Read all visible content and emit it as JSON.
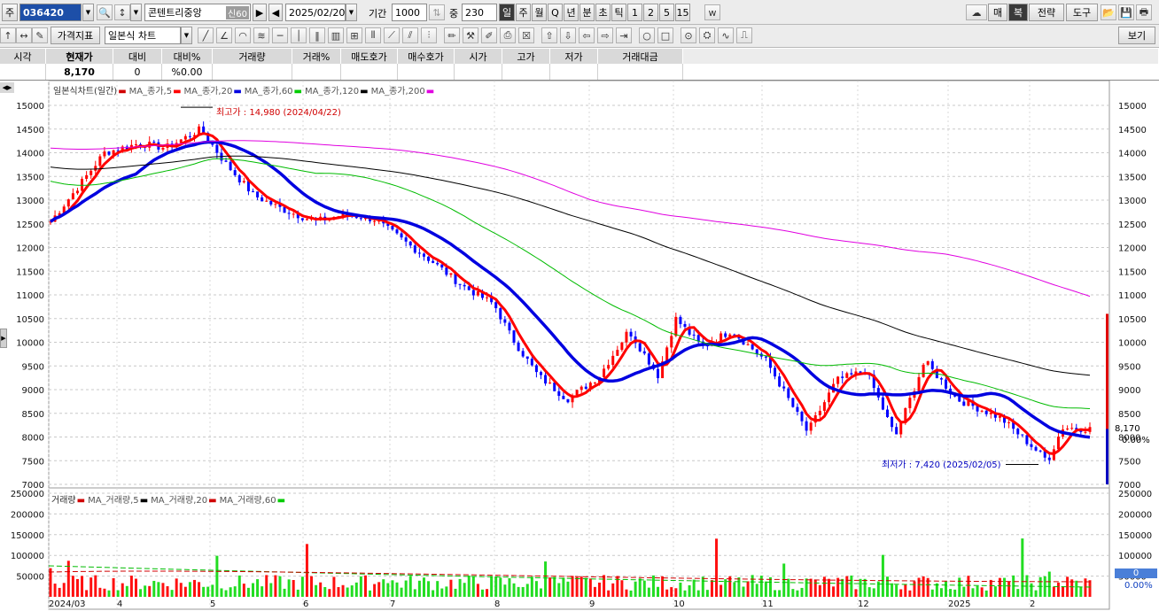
{
  "toolbar1": {
    "market_label": "주",
    "code": "036420",
    "name": "콘텐트리중앙",
    "credit_label": "신",
    "credit_rate": "60",
    "date": "2025/02/20",
    "period_label": "기간",
    "period_value": "1000",
    "weight_label": "중",
    "weight_value": "230",
    "intervals": [
      "일",
      "주",
      "월",
      "Q",
      "년",
      "분",
      "초",
      "틱",
      "1",
      "2",
      "5",
      "15"
    ],
    "right_buttons": [
      "매",
      "복",
      "전략",
      "도구"
    ]
  },
  "toolbar2": {
    "indicator_btn": "가격지표",
    "chart_type": "일본식 차트",
    "view_btn": "보기"
  },
  "quote": {
    "headers": [
      "시각",
      "현재가",
      "대비",
      "대비%",
      "거래량",
      "거래%",
      "매도호가",
      "매수호가",
      "시가",
      "고가",
      "저가",
      "거래대금"
    ],
    "values": [
      "",
      "8,170",
      "0",
      "%0.00",
      "",
      "",
      "",
      "",
      "",
      "",
      "",
      ""
    ]
  },
  "price_legend": [
    {
      "text": "일본식차트(일간)",
      "color": "#d00000"
    },
    {
      "text": "MA_종가,5",
      "color": "#ff0000"
    },
    {
      "text": "MA_종가,20",
      "color": "#0000e0"
    },
    {
      "text": "MA_종가,60",
      "color": "#00cc00"
    },
    {
      "text": "MA_종가,120",
      "color": "#000000"
    },
    {
      "text": "MA_종가,200",
      "color": "#e000e0"
    }
  ],
  "volume_legend": [
    {
      "text": "거래량",
      "color": "#d00000"
    },
    {
      "text": "MA_거래량,5",
      "color": "#000000"
    },
    {
      "text": "MA_거래량,20",
      "color": "#d00000"
    },
    {
      "text": "MA_거래량,60",
      "color": "#00cc00"
    }
  ],
  "annotations": {
    "high": "최고가 : 14,980 (2024/04/22)",
    "low": "최저가 : 7,420 (2025/02/05)",
    "current_price": "8,170",
    "current_change": "0.00%",
    "volume_value": "0",
    "volume_change": "0.00%"
  },
  "chart_data": {
    "type": "candlestick",
    "price_axis": {
      "min": 7000,
      "max": 15000,
      "ticks": [
        "15000",
        "14500",
        "14000",
        "13500",
        "13000",
        "12500",
        "12000",
        "11500",
        "11000",
        "10500",
        "10000",
        "9500",
        "9000",
        "8500",
        "8000",
        "7500",
        "7000"
      ]
    },
    "volume_axis": {
      "ticks": [
        "250000",
        "200000",
        "150000",
        "100000",
        "50000"
      ]
    },
    "x_labels": [
      "2024/03",
      "4",
      "5",
      "6",
      "7",
      "8",
      "9",
      "10",
      "11",
      "12",
      "2025",
      "2"
    ],
    "close_path": [
      [
        "2024-03-01",
        12500
      ],
      [
        "2024-03-10",
        13200
      ],
      [
        "2024-03-20",
        14000
      ],
      [
        "2024-04-01",
        14200
      ],
      [
        "2024-04-10",
        14100
      ],
      [
        "2024-04-22",
        14500
      ],
      [
        "2024-04-30",
        13800
      ],
      [
        "2024-05-10",
        13100
      ],
      [
        "2024-05-20",
        12800
      ],
      [
        "2024-05-31",
        12550
      ],
      [
        "2024-06-10",
        12700
      ],
      [
        "2024-06-20",
        12600
      ],
      [
        "2024-07-01",
        12100
      ],
      [
        "2024-07-10",
        11700
      ],
      [
        "2024-07-20",
        11200
      ],
      [
        "2024-07-31",
        10800
      ],
      [
        "2024-08-06",
        10100
      ],
      [
        "2024-08-15",
        9300
      ],
      [
        "2024-08-25",
        8800
      ],
      [
        "2024-09-01",
        9100
      ],
      [
        "2024-09-05",
        9300
      ],
      [
        "2024-09-15",
        10250
      ],
      [
        "2024-09-25",
        9300
      ],
      [
        "2024-10-01",
        10500
      ],
      [
        "2024-10-10",
        9900
      ],
      [
        "2024-10-20",
        10250
      ],
      [
        "2024-11-01",
        9600
      ],
      [
        "2024-11-15",
        8100
      ],
      [
        "2024-11-25",
        9200
      ],
      [
        "2024-12-05",
        9400
      ],
      [
        "2024-12-15",
        8000
      ],
      [
        "2024-12-25",
        9600
      ],
      [
        "2025-01-05",
        8800
      ],
      [
        "2025-01-20",
        8400
      ],
      [
        "2025-02-05",
        7500
      ],
      [
        "2025-02-10",
        8200
      ],
      [
        "2025-02-20",
        8170
      ]
    ],
    "series": [
      {
        "name": "MA_종가,5",
        "color": "#ff0000"
      },
      {
        "name": "MA_종가,20",
        "color": "#0000e0"
      },
      {
        "name": "MA_종가,60",
        "color": "#00cc00"
      },
      {
        "name": "MA_종가,120",
        "color": "#000000"
      },
      {
        "name": "MA_종가,200",
        "color": "#e000e0"
      }
    ]
  }
}
